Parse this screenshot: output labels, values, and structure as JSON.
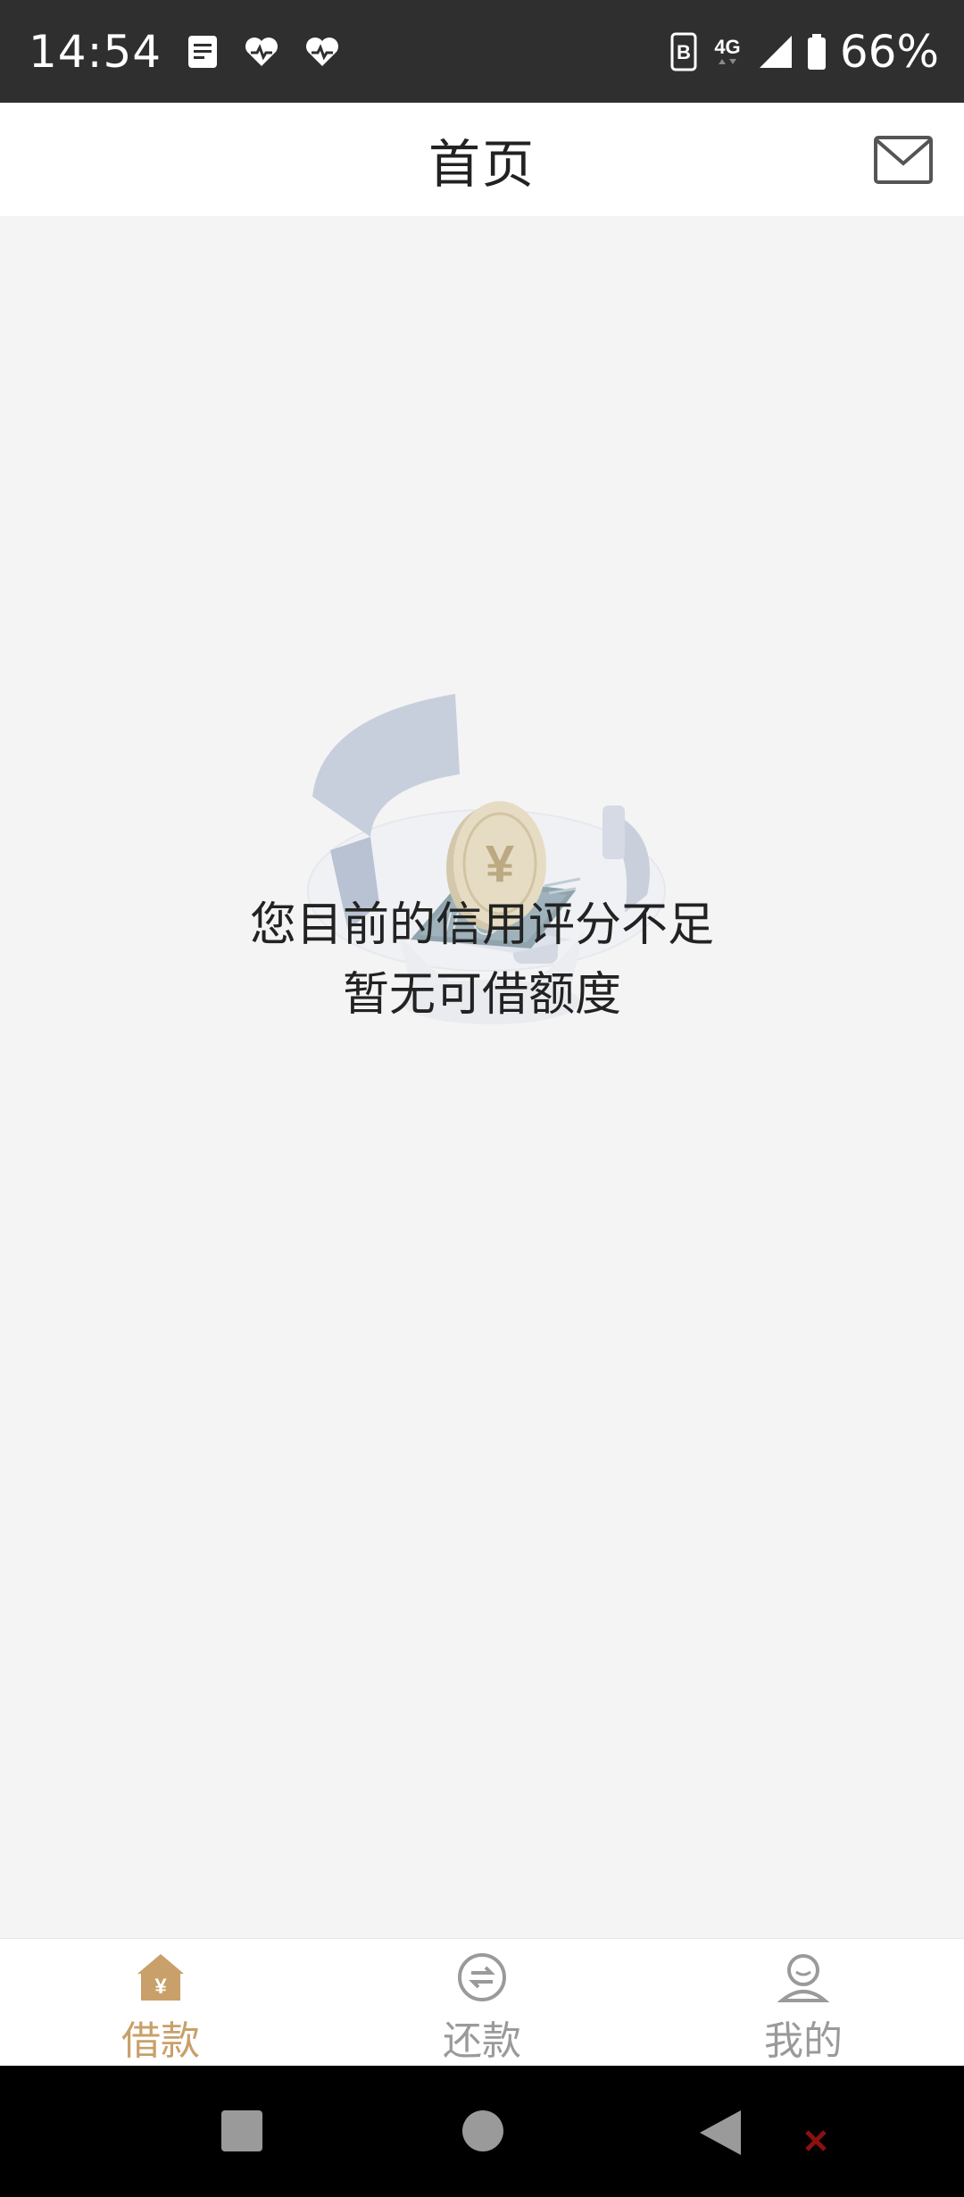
{
  "status_bar": {
    "time": "14:54",
    "battery": "66%",
    "network": "4G",
    "icons": [
      "notes-icon",
      "health-icon",
      "health-icon",
      "hd-icon",
      "signal-icon",
      "battery-icon"
    ]
  },
  "header": {
    "title": "首页",
    "mail_icon": "mail-icon"
  },
  "main": {
    "message_line1": "您目前的信用评分不足",
    "message_line2": "暂无可借额度",
    "illustration": "coin-shield-illustration"
  },
  "bottom_nav": {
    "items": [
      {
        "label": "借款",
        "icon": "loan-home-icon",
        "active": true
      },
      {
        "label": "还款",
        "icon": "repay-icon",
        "active": false
      },
      {
        "label": "我的",
        "icon": "profile-icon",
        "active": false
      }
    ],
    "active_color": "#c9a06a",
    "inactive_color": "#9a9a9a"
  },
  "system_nav": {
    "buttons": [
      "recents-button",
      "home-button",
      "back-button"
    ]
  }
}
